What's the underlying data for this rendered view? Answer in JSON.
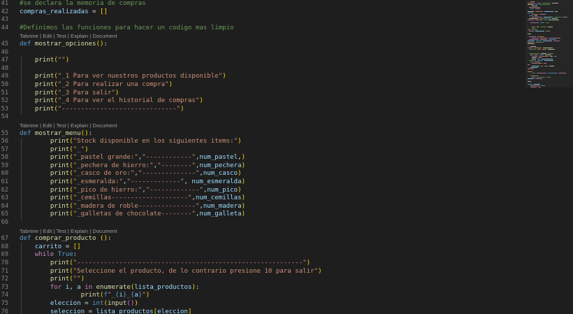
{
  "editor": {
    "code_lens": "Tabnine | Edit | Test | Explain | Document",
    "lines": [
      {
        "type": "code",
        "num": "41",
        "tokens": [
          {
            "t": "#se declara la memoria de compras",
            "c": "comment"
          }
        ]
      },
      {
        "type": "code",
        "num": "42",
        "tokens": [
          {
            "t": "compras_realizadas",
            "c": "var"
          },
          {
            "t": " = ",
            "c": "plain"
          },
          {
            "t": "[]",
            "c": "br1"
          }
        ]
      },
      {
        "type": "code",
        "num": "43",
        "tokens": []
      },
      {
        "type": "code",
        "num": "44",
        "tokens": [
          {
            "t": "#Definimos las funciones para hacer un codigo mas limpio",
            "c": "comment"
          }
        ]
      },
      {
        "type": "lens"
      },
      {
        "type": "code",
        "num": "45",
        "tokens": [
          {
            "t": "def ",
            "c": "kw"
          },
          {
            "t": "mostrar_opciones",
            "c": "fn"
          },
          {
            "t": "()",
            "c": "br1"
          },
          {
            "t": ":",
            "c": "plain"
          }
        ]
      },
      {
        "type": "code",
        "num": "46",
        "tokens": []
      },
      {
        "type": "code",
        "num": "47",
        "tokens": [
          {
            "t": "    ",
            "c": "plain"
          },
          {
            "t": "print",
            "c": "fn"
          },
          {
            "t": "(",
            "c": "br1"
          },
          {
            "t": "\"\"",
            "c": "str"
          },
          {
            "t": ")",
            "c": "br1"
          }
        ]
      },
      {
        "type": "code",
        "num": "48",
        "tokens": []
      },
      {
        "type": "code",
        "num": "49",
        "tokens": [
          {
            "t": "    ",
            "c": "plain"
          },
          {
            "t": "print",
            "c": "fn"
          },
          {
            "t": "(",
            "c": "br1"
          },
          {
            "t": "\"_1 Para ver nuestros productos disponible\"",
            "c": "str"
          },
          {
            "t": ")",
            "c": "br1"
          }
        ]
      },
      {
        "type": "code",
        "num": "50",
        "tokens": [
          {
            "t": "    ",
            "c": "plain"
          },
          {
            "t": "print",
            "c": "fn"
          },
          {
            "t": "(",
            "c": "br1"
          },
          {
            "t": "\"_2 Para realizar una compra\"",
            "c": "str"
          },
          {
            "t": ")",
            "c": "br1"
          }
        ]
      },
      {
        "type": "code",
        "num": "51",
        "tokens": [
          {
            "t": "    ",
            "c": "plain"
          },
          {
            "t": "print",
            "c": "fn"
          },
          {
            "t": "(",
            "c": "br1"
          },
          {
            "t": "\"_3 Para salir\"",
            "c": "str"
          },
          {
            "t": ")",
            "c": "br1"
          }
        ]
      },
      {
        "type": "code",
        "num": "52",
        "tokens": [
          {
            "t": "    ",
            "c": "plain"
          },
          {
            "t": "print",
            "c": "fn"
          },
          {
            "t": "(",
            "c": "br1"
          },
          {
            "t": "\"_4 Para ver el historial de compras\"",
            "c": "str"
          },
          {
            "t": ")",
            "c": "br1"
          }
        ]
      },
      {
        "type": "code",
        "num": "53",
        "tokens": [
          {
            "t": "    ",
            "c": "plain"
          },
          {
            "t": "print",
            "c": "fn"
          },
          {
            "t": "(",
            "c": "br1"
          },
          {
            "t": "\"------------------------------\"",
            "c": "str"
          },
          {
            "t": ")",
            "c": "br1"
          }
        ]
      },
      {
        "type": "code",
        "num": "54",
        "tokens": []
      },
      {
        "type": "lens"
      },
      {
        "type": "code",
        "num": "55",
        "tokens": [
          {
            "t": "def ",
            "c": "kw"
          },
          {
            "t": "mostrar_menu",
            "c": "fn"
          },
          {
            "t": "()",
            "c": "br1"
          },
          {
            "t": ":",
            "c": "plain"
          }
        ]
      },
      {
        "type": "code",
        "num": "56",
        "tokens": [
          {
            "t": "        ",
            "c": "plain"
          },
          {
            "t": "print",
            "c": "fn"
          },
          {
            "t": "(",
            "c": "br1"
          },
          {
            "t": "\"Stock disponible en los siguientes items:\"",
            "c": "str"
          },
          {
            "t": ")",
            "c": "br1"
          }
        ]
      },
      {
        "type": "code",
        "num": "57",
        "tokens": [
          {
            "t": "        ",
            "c": "plain"
          },
          {
            "t": "print",
            "c": "fn"
          },
          {
            "t": "(",
            "c": "br1"
          },
          {
            "t": "\"_\"",
            "c": "str"
          },
          {
            "t": ")",
            "c": "br1"
          }
        ]
      },
      {
        "type": "code",
        "num": "58",
        "tokens": [
          {
            "t": "        ",
            "c": "plain"
          },
          {
            "t": "print",
            "c": "fn"
          },
          {
            "t": "(",
            "c": "br1"
          },
          {
            "t": "\"_pastel grande:\"",
            "c": "str"
          },
          {
            "t": ",",
            "c": "plain"
          },
          {
            "t": "\"------------\"",
            "c": "str"
          },
          {
            "t": ",",
            "c": "plain"
          },
          {
            "t": "num_pastel",
            "c": "var"
          },
          {
            "t": ",",
            "c": "plain"
          },
          {
            "t": ")",
            "c": "br1"
          }
        ]
      },
      {
        "type": "code",
        "num": "59",
        "tokens": [
          {
            "t": "        ",
            "c": "plain"
          },
          {
            "t": "print",
            "c": "fn"
          },
          {
            "t": "(",
            "c": "br1"
          },
          {
            "t": "\"_pechera de hierro:\"",
            "c": "str"
          },
          {
            "t": ",",
            "c": "plain"
          },
          {
            "t": "\"--------\"",
            "c": "str"
          },
          {
            "t": ",",
            "c": "plain"
          },
          {
            "t": "num_pechera",
            "c": "var"
          },
          {
            "t": ")",
            "c": "br1"
          }
        ]
      },
      {
        "type": "code",
        "num": "60",
        "tokens": [
          {
            "t": "        ",
            "c": "plain"
          },
          {
            "t": "print",
            "c": "fn"
          },
          {
            "t": "(",
            "c": "br1"
          },
          {
            "t": "\"_casco de oro:\"",
            "c": "str"
          },
          {
            "t": ",",
            "c": "plain"
          },
          {
            "t": "\"--------------\"",
            "c": "str"
          },
          {
            "t": ",",
            "c": "plain"
          },
          {
            "t": "num_casco",
            "c": "var"
          },
          {
            "t": ")",
            "c": "br1"
          }
        ]
      },
      {
        "type": "code",
        "num": "61",
        "tokens": [
          {
            "t": "        ",
            "c": "plain"
          },
          {
            "t": "print",
            "c": "fn"
          },
          {
            "t": "(",
            "c": "br1"
          },
          {
            "t": "\"_esmeralda:\"",
            "c": "str"
          },
          {
            "t": ",",
            "c": "plain"
          },
          {
            "t": "\"-------------\"",
            "c": "str"
          },
          {
            "t": ", ",
            "c": "plain"
          },
          {
            "t": "num_esmeralda",
            "c": "var"
          },
          {
            "t": ")",
            "c": "br1"
          }
        ]
      },
      {
        "type": "code",
        "num": "62",
        "tokens": [
          {
            "t": "        ",
            "c": "plain"
          },
          {
            "t": "print",
            "c": "fn"
          },
          {
            "t": "(",
            "c": "br1"
          },
          {
            "t": "\"_pico de hierro:\"",
            "c": "str"
          },
          {
            "t": ",",
            "c": "plain"
          },
          {
            "t": "\"-------------\"",
            "c": "str"
          },
          {
            "t": ",",
            "c": "plain"
          },
          {
            "t": "num_pico",
            "c": "var"
          },
          {
            "t": ")",
            "c": "br1"
          }
        ]
      },
      {
        "type": "code",
        "num": "63",
        "tokens": [
          {
            "t": "        ",
            "c": "plain"
          },
          {
            "t": "print",
            "c": "fn"
          },
          {
            "t": "(",
            "c": "br1"
          },
          {
            "t": "\"_cemillas--------------------\"",
            "c": "str"
          },
          {
            "t": ",",
            "c": "plain"
          },
          {
            "t": "num_cemillas",
            "c": "var"
          },
          {
            "t": ")",
            "c": "br1"
          }
        ]
      },
      {
        "type": "code",
        "num": "64",
        "tokens": [
          {
            "t": "        ",
            "c": "plain"
          },
          {
            "t": "print",
            "c": "fn"
          },
          {
            "t": "(",
            "c": "br1"
          },
          {
            "t": "\"_madera de roble---------------\"",
            "c": "str"
          },
          {
            "t": ",",
            "c": "plain"
          },
          {
            "t": "num_madera",
            "c": "var"
          },
          {
            "t": ")",
            "c": "br1"
          }
        ]
      },
      {
        "type": "code",
        "num": "65",
        "tokens": [
          {
            "t": "        ",
            "c": "plain"
          },
          {
            "t": "print",
            "c": "fn"
          },
          {
            "t": "(",
            "c": "br1"
          },
          {
            "t": "\"_galletas de chocolate--------\"",
            "c": "str"
          },
          {
            "t": ",",
            "c": "plain"
          },
          {
            "t": "num_galleta",
            "c": "var"
          },
          {
            "t": ")",
            "c": "br1"
          }
        ]
      },
      {
        "type": "code",
        "num": "66",
        "tokens": []
      },
      {
        "type": "lens"
      },
      {
        "type": "code",
        "num": "67",
        "tokens": [
          {
            "t": "def ",
            "c": "kw"
          },
          {
            "t": "comprar_producto",
            "c": "fn"
          },
          {
            "t": " ",
            "c": "plain"
          },
          {
            "t": "()",
            "c": "br1"
          },
          {
            "t": ":",
            "c": "plain"
          }
        ]
      },
      {
        "type": "code",
        "num": "68",
        "tokens": [
          {
            "t": "    ",
            "c": "plain"
          },
          {
            "t": "carrito",
            "c": "var"
          },
          {
            "t": " = ",
            "c": "plain"
          },
          {
            "t": "[]",
            "c": "br1"
          }
        ]
      },
      {
        "type": "code",
        "num": "69",
        "tokens": [
          {
            "t": "    ",
            "c": "plain"
          },
          {
            "t": "while ",
            "c": "ctrl"
          },
          {
            "t": "True",
            "c": "kw"
          },
          {
            "t": ":",
            "c": "plain"
          }
        ]
      },
      {
        "type": "code",
        "num": "70",
        "tokens": [
          {
            "t": "        ",
            "c": "plain"
          },
          {
            "t": "print",
            "c": "fn"
          },
          {
            "t": "(",
            "c": "br1"
          },
          {
            "t": "\"-----------------------------------------------------------\"",
            "c": "str"
          },
          {
            "t": ")",
            "c": "br1"
          }
        ]
      },
      {
        "type": "code",
        "num": "71",
        "tokens": [
          {
            "t": "        ",
            "c": "plain"
          },
          {
            "t": "print",
            "c": "fn"
          },
          {
            "t": "(",
            "c": "br1"
          },
          {
            "t": "\"Seleccione el producto, de lo contrario presione 10 para salir\"",
            "c": "str"
          },
          {
            "t": ")",
            "c": "br1"
          }
        ]
      },
      {
        "type": "code",
        "num": "72",
        "tokens": [
          {
            "t": "        ",
            "c": "plain"
          },
          {
            "t": "print",
            "c": "fn"
          },
          {
            "t": "(",
            "c": "br1"
          },
          {
            "t": "\"\"",
            "c": "str"
          },
          {
            "t": ")",
            "c": "br1"
          }
        ]
      },
      {
        "type": "code",
        "num": "73",
        "tokens": [
          {
            "t": "        ",
            "c": "plain"
          },
          {
            "t": "for ",
            "c": "ctrl"
          },
          {
            "t": "i",
            "c": "var"
          },
          {
            "t": ", ",
            "c": "plain"
          },
          {
            "t": "a",
            "c": "var"
          },
          {
            "t": " in ",
            "c": "ctrl"
          },
          {
            "t": "enumerate",
            "c": "fn"
          },
          {
            "t": "(",
            "c": "br1"
          },
          {
            "t": "lista_productos",
            "c": "var"
          },
          {
            "t": ")",
            "c": "br1"
          },
          {
            "t": ":",
            "c": "plain"
          }
        ]
      },
      {
        "type": "code",
        "num": "74",
        "tokens": [
          {
            "t": "                ",
            "c": "plain"
          },
          {
            "t": "print",
            "c": "fn"
          },
          {
            "t": "(",
            "c": "br1"
          },
          {
            "t": "f",
            "c": "kw"
          },
          {
            "t": "\"_",
            "c": "str"
          },
          {
            "t": "{",
            "c": "kw"
          },
          {
            "t": "i",
            "c": "var"
          },
          {
            "t": "}",
            "c": "kw"
          },
          {
            "t": "_",
            "c": "str"
          },
          {
            "t": "{",
            "c": "kw"
          },
          {
            "t": "a",
            "c": "var"
          },
          {
            "t": "}",
            "c": "kw"
          },
          {
            "t": "\"",
            "c": "str"
          },
          {
            "t": ")",
            "c": "br1"
          }
        ]
      },
      {
        "type": "code",
        "num": "75",
        "tokens": [
          {
            "t": "        ",
            "c": "plain"
          },
          {
            "t": "eleccion",
            "c": "var"
          },
          {
            "t": " = ",
            "c": "plain"
          },
          {
            "t": "int",
            "c": "kw"
          },
          {
            "t": "(",
            "c": "br1"
          },
          {
            "t": "input",
            "c": "fn"
          },
          {
            "t": "()",
            "c": "br2"
          },
          {
            "t": ")",
            "c": "br1"
          }
        ]
      },
      {
        "type": "code",
        "num": "76",
        "tokens": [
          {
            "t": "        ",
            "c": "plain"
          },
          {
            "t": "seleccion",
            "c": "var"
          },
          {
            "t": " = ",
            "c": "plain"
          },
          {
            "t": "lista_productos",
            "c": "var"
          },
          {
            "t": "[",
            "c": "br1"
          },
          {
            "t": "eleccion",
            "c": "var"
          },
          {
            "t": "]",
            "c": "br1"
          }
        ]
      }
    ]
  },
  "colors": {
    "background": "#1e1e1e",
    "comment": "#6a9955",
    "keyword": "#569cd6",
    "control": "#c586c0",
    "function": "#dcdcaa",
    "string": "#ce9178",
    "variable": "#9cdcfe",
    "plain": "#d4d4d4",
    "bracket_1": "#ffd700",
    "bracket_2": "#da70d6",
    "line_number": "#858585",
    "code_lens": "#9d9d9d"
  }
}
